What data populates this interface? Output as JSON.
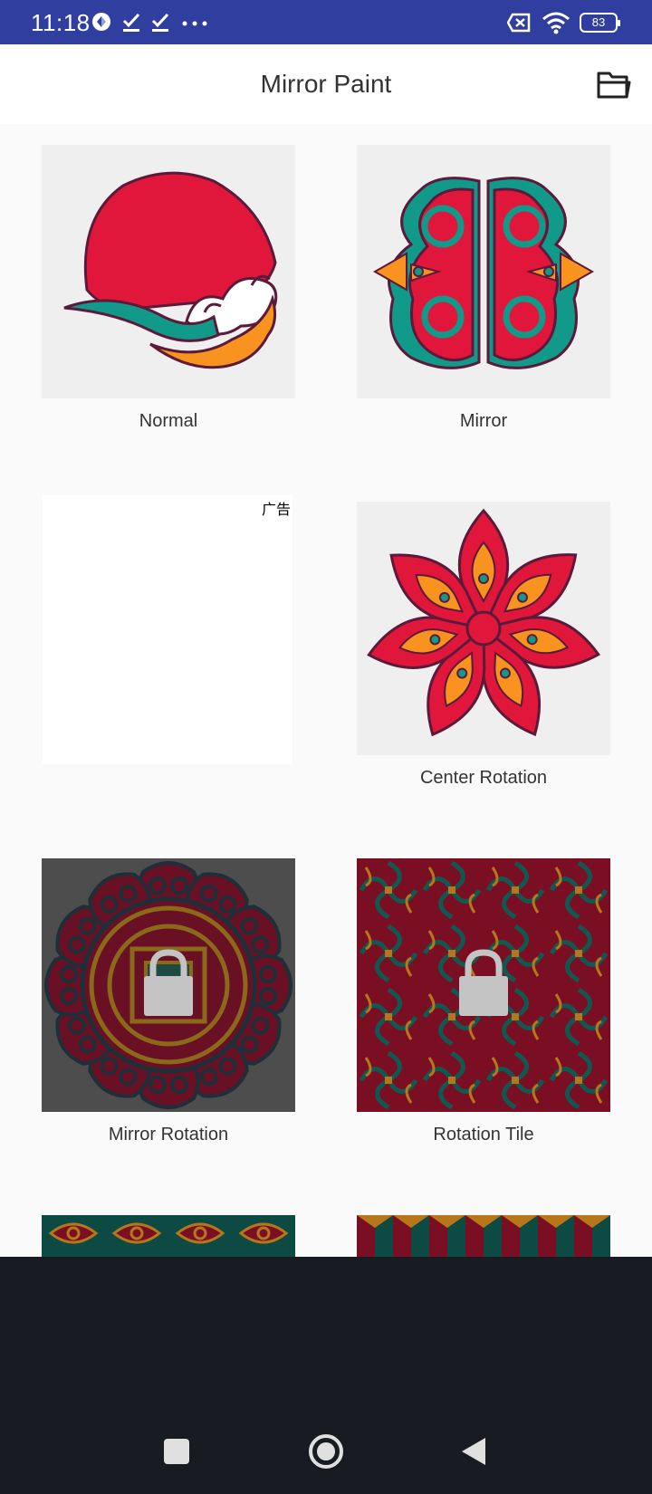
{
  "status_bar": {
    "time": "11:18",
    "battery": "83"
  },
  "app_bar": {
    "title": "Mirror Paint",
    "folder_icon": "folder-icon"
  },
  "modes": [
    {
      "label": "Normal",
      "locked": false
    },
    {
      "label": "Mirror",
      "locked": false
    },
    {
      "label": "Center Rotation",
      "locked": false
    },
    {
      "label": "Mirror Rotation",
      "locked": true
    },
    {
      "label": "Rotation Tile",
      "locked": true
    }
  ],
  "ad": {
    "label": "广告"
  },
  "colors": {
    "status_bar": "#303f9f",
    "red": "#e0173a",
    "teal": "#11998a",
    "orange": "#f7931e",
    "outline": "#5c1a3a",
    "nav_bar": "#181b22"
  }
}
